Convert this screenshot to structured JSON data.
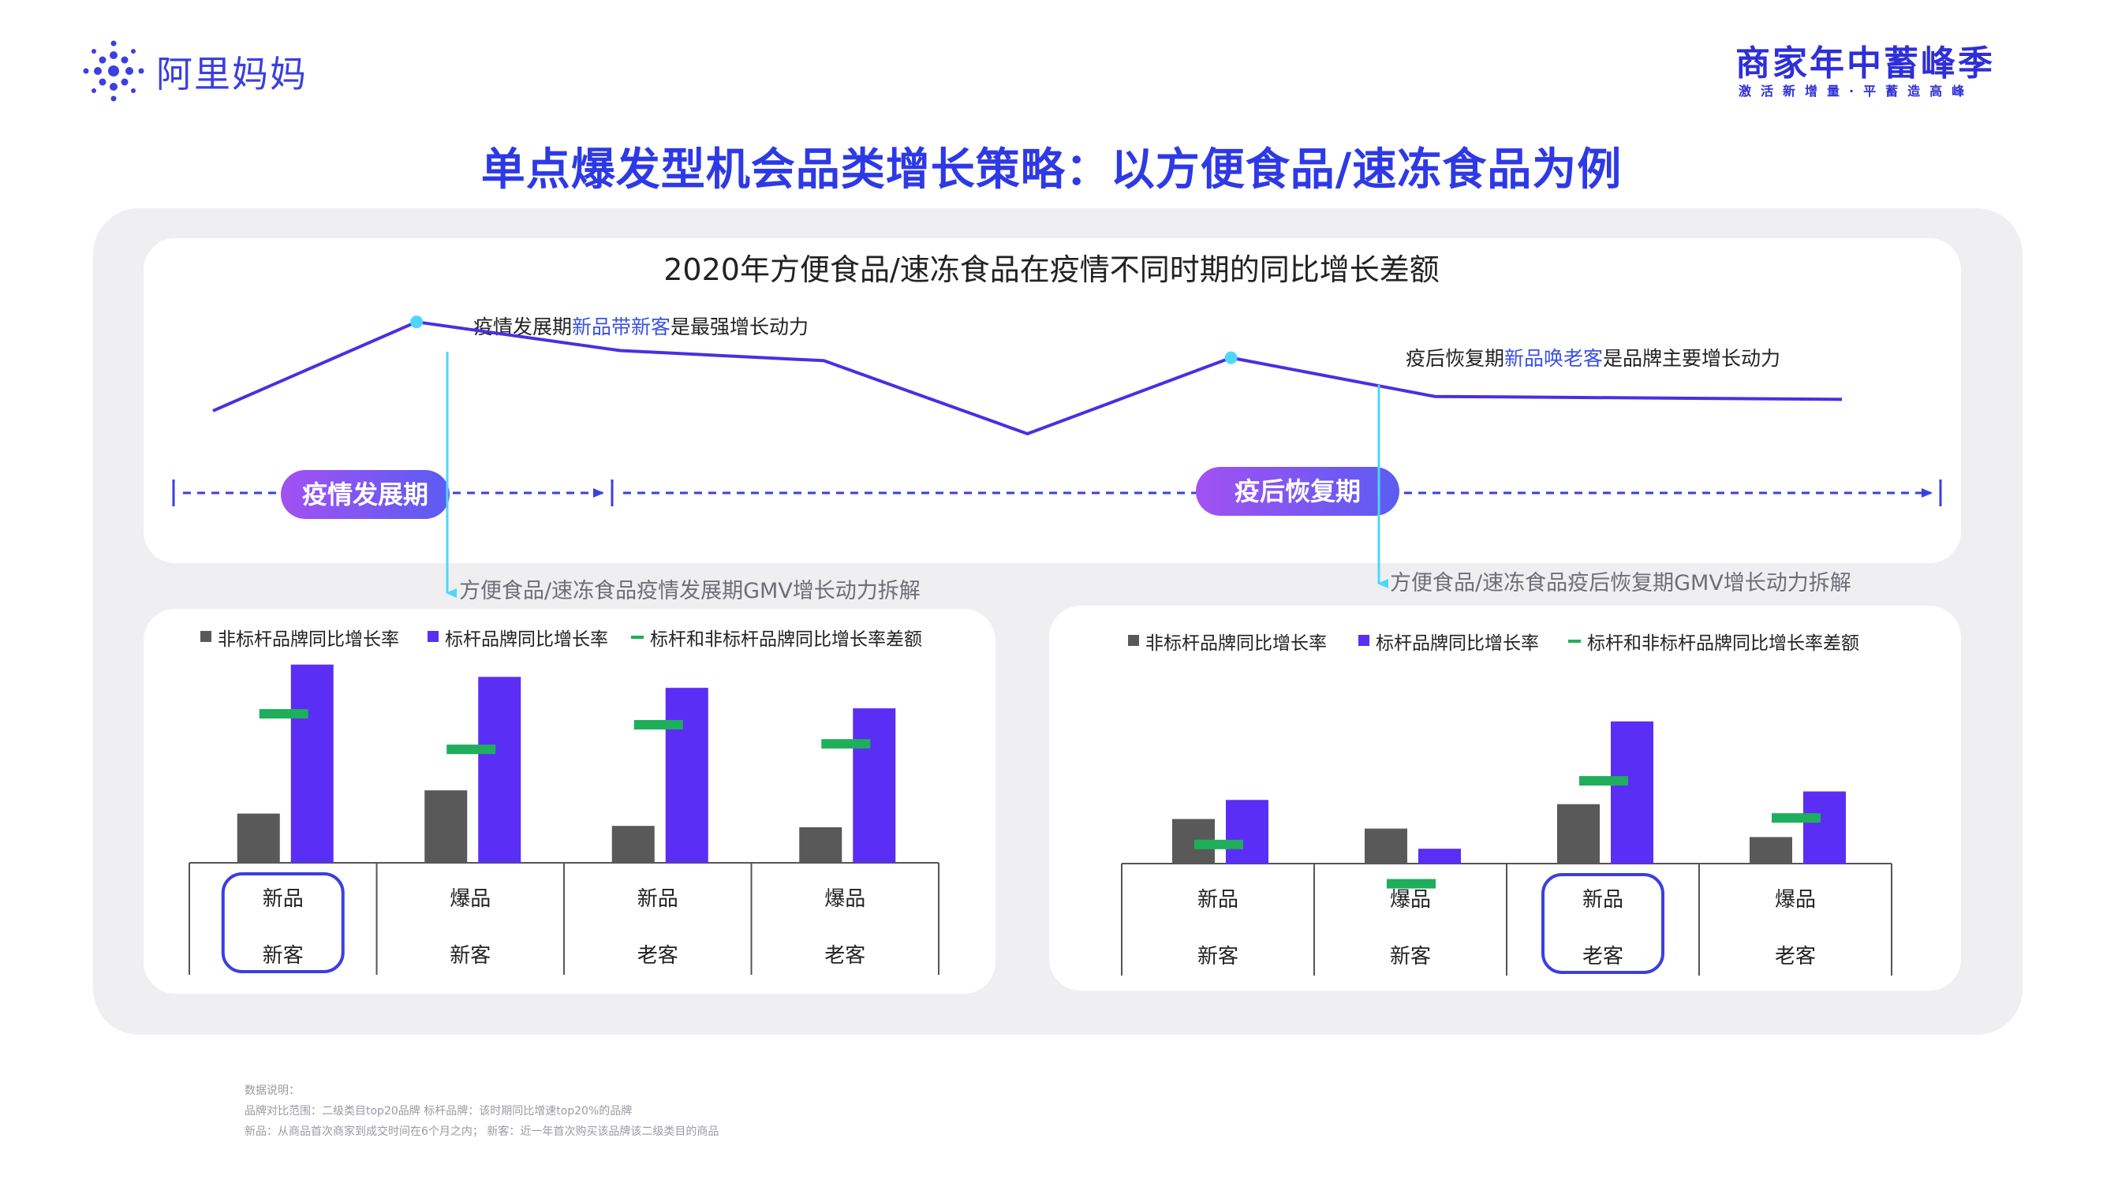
{
  "header": {
    "logo_text": "阿里妈妈",
    "brand_title": "商家年中蓄峰季",
    "brand_slogan": "激活新增量·平蓄造高峰",
    "main_title": "单点爆发型机会品类增长策略：以方便食品/速冻食品为例"
  },
  "top_chart": {
    "title": "2020年方便食品/速冻食品在疫情不同时期的同比增长差额",
    "callout_left": {
      "prefix": "疫情发展期",
      "highlight": "新品带新客",
      "suffix": "是最强增长动力"
    },
    "callout_right": {
      "prefix": "疫后恢复期",
      "highlight": "新品唤老客",
      "suffix": "是品牌主要增长动力"
    },
    "phase_left": "疫情发展期",
    "phase_right": "疫后恢复期",
    "sub_left": "方便食品/速冻食品疫情发展期GMV增长动力拆解",
    "sub_right": "方便食品/速冻食品疫后恢复期GMV增长动力拆解"
  },
  "legend": {
    "non_benchmark": "非标杆品牌同比增长率",
    "benchmark": "标杆品牌同比增长率",
    "diff": "标杆和非标杆品牌同比增长率差额"
  },
  "colors": {
    "accent": "#2e39e6",
    "line": "#4b2fe0",
    "non_benchmark": "#595959",
    "benchmark": "#5a2ef5",
    "diff": "#1fae5b",
    "cyan": "#4fd6ff",
    "phase_gradient_start": "#9b4df2",
    "phase_gradient_end": "#5b5cf2"
  },
  "chart_data": [
    {
      "type": "line",
      "x": [
        1,
        2,
        3,
        4,
        5,
        6,
        7,
        8,
        9
      ],
      "values": [
        38,
        100,
        80,
        73,
        22,
        75,
        48,
        47,
        46
      ],
      "markers": [
        2,
        6
      ],
      "ylim": [
        0,
        110
      ]
    },
    {
      "type": "bar",
      "title": "方便食品/速冻食品疫情发展期GMV增长动力拆解",
      "categories": [
        [
          "新品",
          "新客"
        ],
        [
          "爆品",
          "新客"
        ],
        [
          "新品",
          "老客"
        ],
        [
          "爆品",
          "老客"
        ]
      ],
      "highlight_index": 0,
      "series": [
        {
          "name": "非标杆品牌同比增长率",
          "values": [
            36,
            53,
            27,
            26
          ]
        },
        {
          "name": "标杆品牌同比增长率",
          "values": [
            145,
            136,
            128,
            113
          ]
        },
        {
          "name": "标杆和非标杆品牌同比增长率差额",
          "values": [
            109,
            83,
            101,
            87
          ]
        }
      ],
      "ylim": [
        0,
        150
      ]
    },
    {
      "type": "bar",
      "title": "方便食品/速冻食品疫后恢复期GMV增长动力拆解",
      "categories": [
        [
          "新品",
          "新客"
        ],
        [
          "爆品",
          "新客"
        ],
        [
          "新品",
          "老客"
        ],
        [
          "爆品",
          "老客"
        ]
      ],
      "highlight_index": 2,
      "series": [
        {
          "name": "非标杆品牌同比增长率",
          "values": [
            42,
            33,
            56,
            25
          ]
        },
        {
          "name": "标杆品牌同比增长率",
          "values": [
            60,
            14,
            134,
            68
          ]
        },
        {
          "name": "标杆和非标杆品牌同比增长率差额",
          "values": [
            18,
            -19,
            78,
            43
          ]
        }
      ],
      "ylim": [
        -25,
        140
      ]
    }
  ],
  "footnotes": {
    "line1": "数据说明：",
    "line2": "品牌对比范围：二级类目top20品牌 标杆品牌：该时期同比增速top20%的品牌",
    "line3": "新品：从商品首次商家到成交时间在6个月之内；  新客：近一年首次购买该品牌该二级类目的商品"
  }
}
